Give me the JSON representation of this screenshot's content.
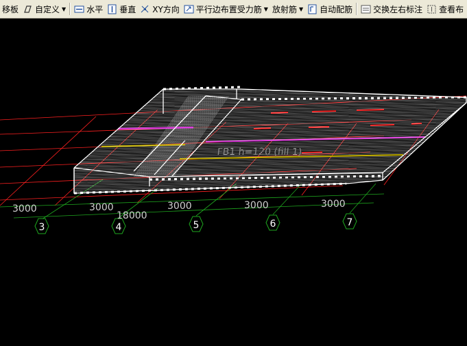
{
  "toolbar": {
    "items": [
      {
        "label": "移板",
        "icon": "slab-icon"
      },
      {
        "label": "自定义",
        "icon": "custom-shape-icon",
        "dropdown": true
      },
      {
        "label": "水平",
        "icon": "horizontal-icon"
      },
      {
        "label": "垂直",
        "icon": "vertical-icon"
      },
      {
        "label": "XY方向",
        "icon": "xy-direction-icon"
      },
      {
        "label": "平行边布置受力筋",
        "icon": "parallel-edge-icon",
        "dropdown": true
      },
      {
        "label": "放射筋",
        "icon": "radial-bar-icon",
        "dropdown": true
      },
      {
        "label": "自动配筋",
        "icon": "auto-rebar-icon"
      },
      {
        "label": "交换左右标注",
        "icon": "swap-label-icon"
      },
      {
        "label": "查看布",
        "icon": "view-layout-icon"
      }
    ]
  },
  "viewport": {
    "dimensions": [
      {
        "id": "dim-3-4-left",
        "text": "3000"
      },
      {
        "id": "dim-3-4",
        "text": "3000"
      },
      {
        "id": "dim-4-5",
        "text": "3000"
      },
      {
        "id": "dim-5-6",
        "text": "3000"
      },
      {
        "id": "dim-6-7",
        "text": "3000"
      },
      {
        "id": "dim-total",
        "text": "18000"
      }
    ],
    "axes": [
      {
        "id": "axis-3",
        "label": "3"
      },
      {
        "id": "axis-4",
        "label": "4"
      },
      {
        "id": "axis-5",
        "label": "5"
      },
      {
        "id": "axis-6",
        "label": "6"
      },
      {
        "id": "axis-7",
        "label": "7"
      }
    ],
    "slab_label": "FB1 h=120 (fill 1)",
    "colors": {
      "background": "#000000",
      "grid_red": "#ff2020",
      "grid_green": "#1fa81f",
      "slab_outline": "#ffffff",
      "hatch": "#c8c8c8",
      "rebar_magenta": "#e040e0",
      "rebar_yellow": "#c8b400",
      "rebar_red": "#ff3030",
      "annotation": "#d0d0d0"
    }
  }
}
